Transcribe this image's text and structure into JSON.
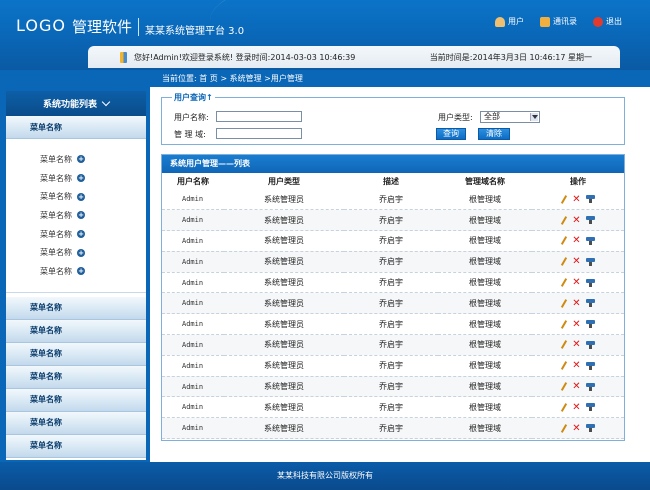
{
  "header": {
    "logo": "LOGO",
    "title": "管理软件",
    "subtitle": "某某系统管理平台 3.0",
    "links": [
      {
        "label": "用户",
        "icon": "user-icon",
        "color": "#f0c070"
      },
      {
        "label": "通讯录",
        "icon": "contacts-icon",
        "color": "#f0b040"
      },
      {
        "label": "退出",
        "icon": "power-icon",
        "color": "#e23b2e"
      }
    ],
    "welcome": "您好!Admin!欢迎登录系统! 登录时间:2014-03-03 10:46:39",
    "current_time": "当前时间是:2014年3月3日  10:46:17   星期一"
  },
  "breadcrumb": "当前位置: 首 页 > 系统管理 >用户管理",
  "sidebar": {
    "title": "系统功能列表",
    "first_menu": "菜单名称",
    "sub_items": [
      "菜单名称",
      "菜单名称",
      "菜单名称",
      "菜单名称",
      "菜单名称",
      "菜单名称",
      "菜单名称"
    ],
    "menus": [
      "菜单名称",
      "菜单名称",
      "菜单名称",
      "菜单名称",
      "菜单名称",
      "菜单名称",
      "菜单名称"
    ]
  },
  "query": {
    "legend": "用户查询↑",
    "username_label": "用户名称:",
    "domain_label": "管 理 域:",
    "type_label": "用户类型:",
    "type_value": "全部",
    "search_btn": "查询",
    "clear_btn": "清除"
  },
  "list": {
    "title": "系统用户管理——列表",
    "columns": [
      "用户名称",
      "用户类型",
      "描述",
      "管理域名称",
      "操作"
    ],
    "rows": [
      [
        "Admin",
        "系统管理员",
        "乔启宇",
        "根管理域"
      ],
      [
        "Admin",
        "系统管理员",
        "乔启宇",
        "根管理域"
      ],
      [
        "Admin",
        "系统管理员",
        "乔启宇",
        "根管理域"
      ],
      [
        "Admin",
        "系统管理员",
        "乔启宇",
        "根管理域"
      ],
      [
        "Admin",
        "系统管理员",
        "乔启宇",
        "根管理域"
      ],
      [
        "Admin",
        "系统管理员",
        "乔启宇",
        "根管理域"
      ],
      [
        "Admin",
        "系统管理员",
        "乔启宇",
        "根管理域"
      ],
      [
        "Admin",
        "系统管理员",
        "乔启宇",
        "根管理域"
      ],
      [
        "Admin",
        "系统管理员",
        "乔启宇",
        "根管理域"
      ],
      [
        "Admin",
        "系统管理员",
        "乔启宇",
        "根管理域"
      ],
      [
        "Admin",
        "系统管理员",
        "乔启宇",
        "根管理域"
      ],
      [
        "Admin",
        "系统管理员",
        "乔启宇",
        "根管理域"
      ]
    ]
  },
  "footer": "某某科技有限公司版权所有"
}
